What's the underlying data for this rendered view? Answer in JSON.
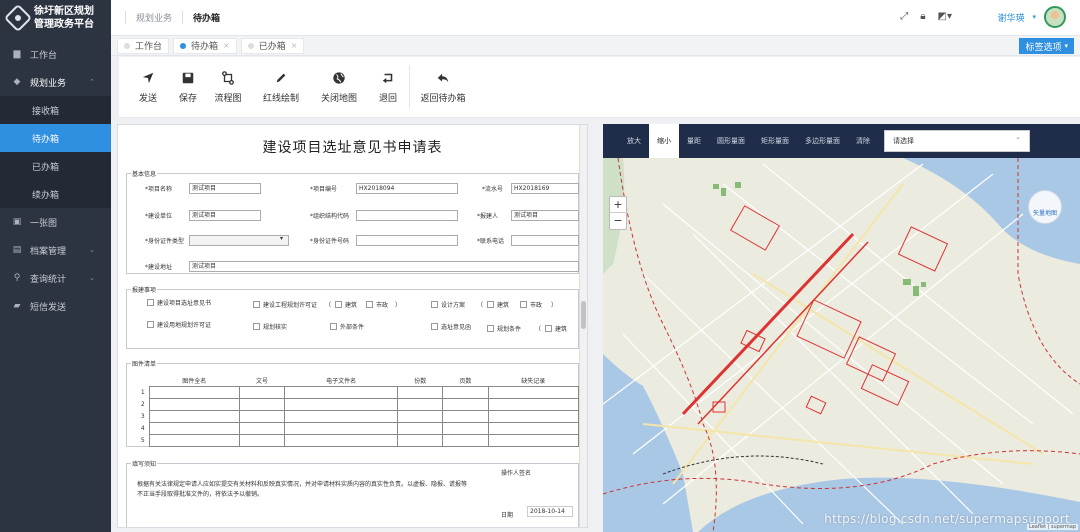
{
  "app": {
    "title_line1": "徐圩新区规划",
    "title_line2": "管理政务平台"
  },
  "sidebar": {
    "items": [
      {
        "label": "工作台",
        "icon": "folder-icon"
      },
      {
        "label": "规划业务",
        "icon": "layers-icon",
        "expanded": true
      },
      {
        "label": "一张图",
        "icon": "image-icon"
      },
      {
        "label": "档案管理",
        "icon": "file-icon"
      },
      {
        "label": "查询统计",
        "icon": "search-icon"
      },
      {
        "label": "短信发送",
        "icon": "message-icon"
      }
    ],
    "sub_items": [
      {
        "label": "接收箱"
      },
      {
        "label": "待办箱",
        "active": true
      },
      {
        "label": "已办箱"
      },
      {
        "label": "续办箱"
      }
    ]
  },
  "header": {
    "breadcrumb_parent": "规划业务",
    "breadcrumb_current": "待办箱",
    "user_name": "谢华瑛"
  },
  "tabs": {
    "items": [
      {
        "label": "工作台"
      },
      {
        "label": "待办箱",
        "active": true
      },
      {
        "label": "已办箱"
      }
    ],
    "options_label": "标签选项"
  },
  "toolbar": {
    "items": [
      {
        "label": "发送",
        "icon": "send-icon"
      },
      {
        "label": "保存",
        "icon": "save-icon"
      },
      {
        "label": "流程图",
        "icon": "flowchart-icon"
      },
      {
        "label": "红线绘制",
        "icon": "pen-icon"
      },
      {
        "label": "关闭地图",
        "icon": "globe-icon"
      },
      {
        "label": "退回",
        "icon": "return-icon"
      },
      {
        "label": "返回待办箱",
        "icon": "reply-icon"
      }
    ]
  },
  "form": {
    "title": "建设项目选址意见书申请表",
    "basic": {
      "legend": "基本信息",
      "project_name_label": "*项目名称",
      "project_name": "测试项目",
      "project_no_label": "*项目编号",
      "project_no": "HX2018094",
      "serial_no_label": "*流水号",
      "serial_no": "HX2018169",
      "build_unit_label": "*建设单位",
      "build_unit": "测试项目",
      "org_code_label": "*组织结构代码",
      "org_code": "",
      "applicant_label": "*报建人",
      "applicant": "测试项目",
      "id_type_label": "*身份证件类型",
      "id_type": "",
      "id_no_label": "*身份证件号码",
      "id_no": "",
      "phone_label": "*联系电话",
      "phone": "",
      "address_label": "*建设地址",
      "address": "测试项目"
    },
    "matters": {
      "legend": "报建事项",
      "items": [
        "建设项目选址意见书",
        "建设工程规划许可证",
        "建筑",
        "市政",
        "设计方案",
        "建筑",
        "市政",
        "建设用地规划许可证",
        "规划核实",
        "外部条件",
        "选址意见函",
        "规划条件",
        "建筑"
      ],
      "paren_open": "（",
      "paren_close": "）"
    },
    "files": {
      "legend": "图件清单",
      "headers": [
        "图件全名",
        "文号",
        "电子文件名",
        "份数",
        "页数",
        "缺失记录"
      ],
      "rows": [
        "1",
        "2",
        "3",
        "4",
        "5"
      ]
    },
    "notice": {
      "legend": "填写须知",
      "text": "根据有关法律规定申请人应如实提交有关材料和反映真实情况，并对申请材料实质内容的真实性负责。以虚报、隐报、谎报等不正当手段取得批准文件的，将依法予以撤销。",
      "operator_label": "操作人签名",
      "date_label": "日期",
      "date": "2018-10-14"
    }
  },
  "map": {
    "tools": [
      "放大",
      "缩小",
      "量距",
      "圆形量面",
      "矩形量面",
      "多边形量面",
      "清除"
    ],
    "active_tool": "缩小",
    "select_placeholder": "请选择",
    "vector_label": "矢量地图",
    "zoom_in": "+",
    "zoom_out": "−",
    "attribution": "Leaflet | supermap",
    "watermark": "https://blog.csdn.net/supermapsupport"
  }
}
